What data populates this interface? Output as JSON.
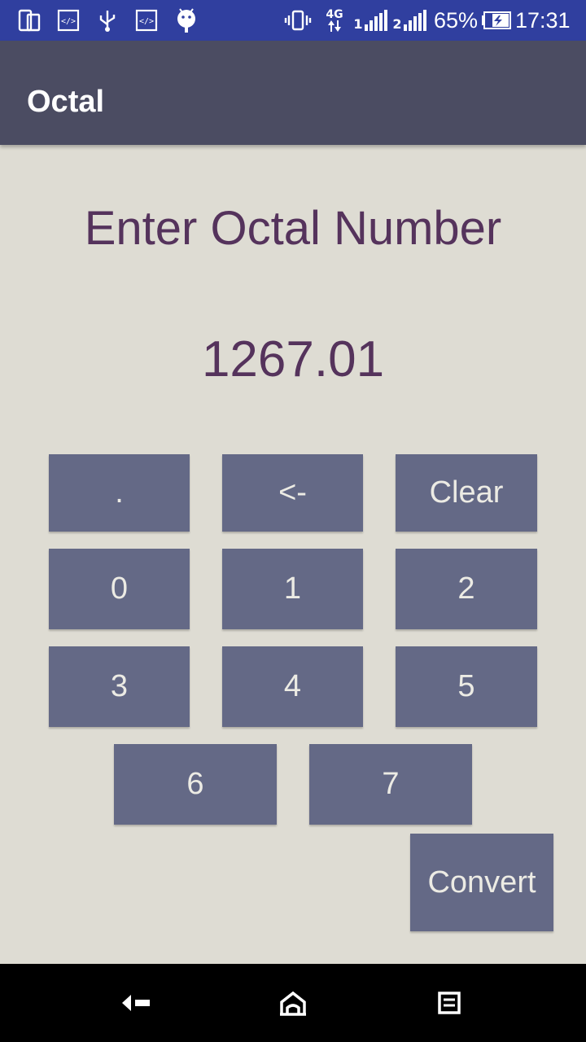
{
  "status_bar": {
    "battery": "65%",
    "time": "17:31",
    "network": "4G",
    "sim1": "1",
    "sim2": "2",
    "icons": [
      "screen-mirror-icon",
      "code-icon",
      "usb-icon",
      "code-icon",
      "android-icon",
      "vibrate-icon",
      "network-4g-icon",
      "signal-sim1-icon",
      "signal-sim2-icon",
      "battery-charging-icon"
    ]
  },
  "app_bar": {
    "title": "Octal"
  },
  "main": {
    "prompt": "Enter Octal Number",
    "display_value": "1267.01"
  },
  "keypad": {
    "dot": ".",
    "backspace": "<-",
    "clear": "Clear",
    "digits": [
      "0",
      "1",
      "2",
      "3",
      "4",
      "5",
      "6",
      "7"
    ],
    "convert": "Convert"
  },
  "nav_bar": {
    "icons": [
      "back-icon",
      "home-icon",
      "recents-icon"
    ]
  },
  "colors": {
    "status_bar": "#303f9f",
    "app_bar": "#4b4c62",
    "background": "#dedcd3",
    "key": "#646986",
    "key_text": "#ecebe4",
    "accent_text": "#55335c"
  }
}
